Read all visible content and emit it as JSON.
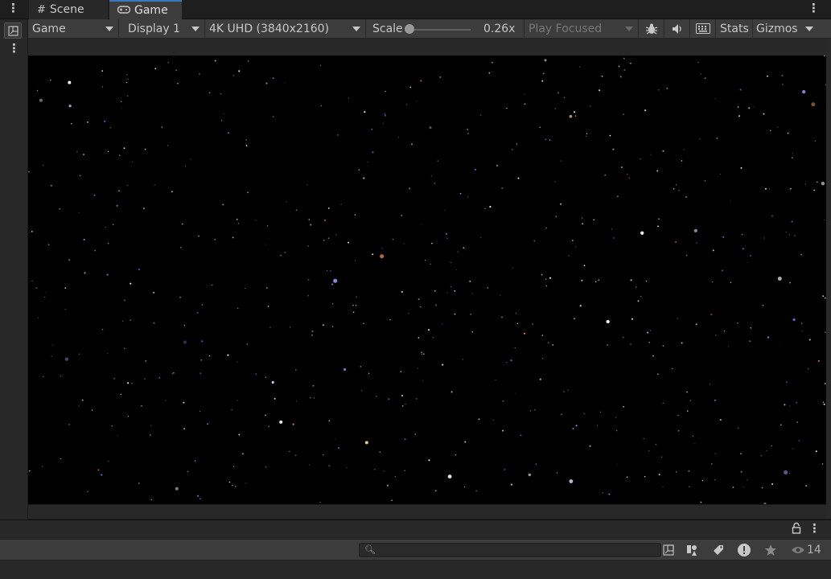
{
  "tabs": [
    {
      "label": "Scene",
      "icon": "grid-hash-icon",
      "active": false
    },
    {
      "label": "Game",
      "icon": "gamepad-icon",
      "active": true
    }
  ],
  "toolbar": {
    "display_mode": "Game",
    "display": "Display 1",
    "resolution": "4K UHD (3840x2160)",
    "scale_label": "Scale",
    "scale_value": "0.26x",
    "play_mode": "Play Focused",
    "stats_label": "Stats",
    "gizmos_label": "Gizmos"
  },
  "console": {
    "search_placeholder": "",
    "visible_count": "14"
  },
  "colors": {
    "accent": "#3a79bb",
    "panel": "#3c3c3c",
    "dark_panel": "#282828",
    "game_bg": "#000000"
  }
}
